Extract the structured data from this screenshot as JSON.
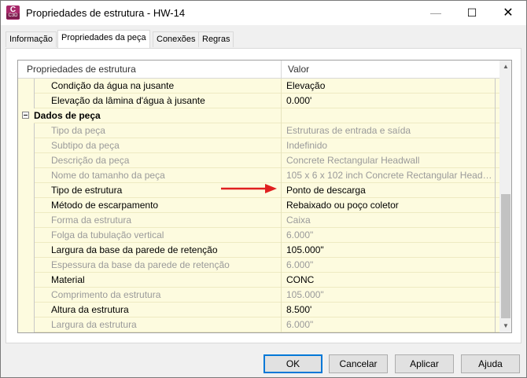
{
  "window": {
    "title": "Propriedades de estrutura - HW-14",
    "icon": {
      "letter": "C",
      "version": "C3D",
      "name": "civil3d-app-icon"
    },
    "controls": {
      "minimize": "—",
      "maximize": "☐",
      "close": "✕"
    }
  },
  "tabs": [
    {
      "label": "Informação",
      "active": false
    },
    {
      "label": "Propriedades da peça",
      "active": true
    },
    {
      "label": "Conexões",
      "active": false
    },
    {
      "label": "Regras",
      "active": false
    }
  ],
  "grid": {
    "headers": {
      "property": "Propriedades de estrutura",
      "value": "Valor"
    },
    "rows": [
      {
        "name": "Condição da água na jusante",
        "value": "Elevação",
        "disabled": false,
        "type": "prop"
      },
      {
        "name": "Elevação da lâmina d'água à jusante",
        "value": "0.000'",
        "disabled": false,
        "type": "prop"
      },
      {
        "name": "Dados de peça",
        "value": "",
        "disabled": false,
        "type": "category"
      },
      {
        "name": "Tipo da peça",
        "value": "Estruturas de entrada e saída",
        "disabled": true,
        "type": "prop"
      },
      {
        "name": "Subtipo da peça",
        "value": "Indefinido",
        "disabled": true,
        "type": "prop"
      },
      {
        "name": "Descrição da peça",
        "value": "Concrete Rectangular Headwall",
        "disabled": true,
        "type": "prop"
      },
      {
        "name": "Nome do tamanho da peça",
        "value": "105 x 6 x 102 inch Concrete Rectangular Headw...",
        "disabled": true,
        "type": "prop"
      },
      {
        "name": "Tipo de estrutura",
        "value": "Ponto de descarga",
        "disabled": false,
        "type": "prop"
      },
      {
        "name": "Método de escarpamento",
        "value": "Rebaixado ou poço coletor",
        "disabled": false,
        "type": "prop"
      },
      {
        "name": "Forma da estrutura",
        "value": "Caixa",
        "disabled": true,
        "type": "prop"
      },
      {
        "name": "Folga da tubulação vertical",
        "value": "6.000\"",
        "disabled": true,
        "type": "prop"
      },
      {
        "name": "Largura da base da parede de retenção",
        "value": "105.000\"",
        "disabled": false,
        "type": "prop"
      },
      {
        "name": "Espessura da base da parede de retenção",
        "value": "6.000\"",
        "disabled": true,
        "type": "prop"
      },
      {
        "name": "Material",
        "value": "CONC",
        "disabled": false,
        "type": "prop"
      },
      {
        "name": "Comprimento da estrutura",
        "value": "105.000\"",
        "disabled": true,
        "type": "prop"
      },
      {
        "name": "Altura da estrutura",
        "value": "8.500'",
        "disabled": false,
        "type": "prop"
      },
      {
        "name": "Largura da estrutura",
        "value": "6.000\"",
        "disabled": true,
        "type": "prop"
      }
    ]
  },
  "annotation": {
    "arrow_color": "#e02020"
  },
  "buttons": {
    "ok": "OK",
    "cancel": "Cancelar",
    "apply": "Aplicar",
    "help": "Ajuda"
  },
  "scrollbar": {
    "up": "▲",
    "down": "▼"
  }
}
